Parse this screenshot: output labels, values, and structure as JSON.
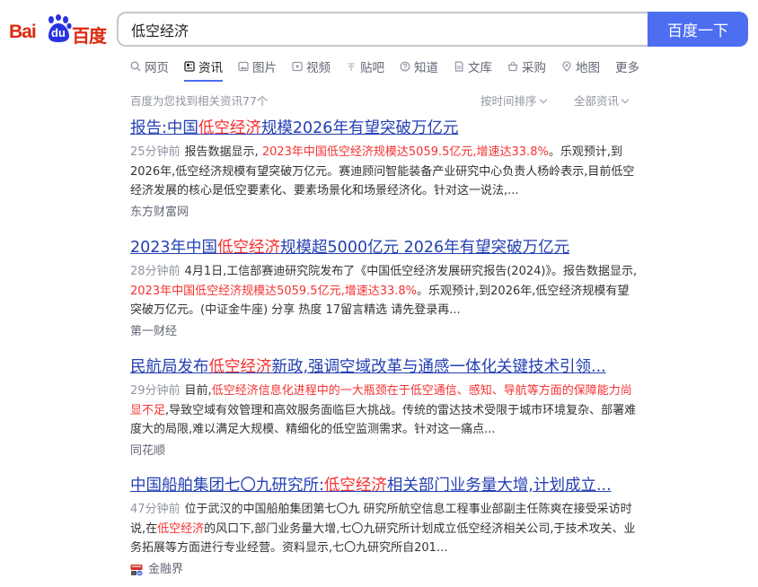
{
  "logo": {
    "bai": "Bai",
    "du": "du",
    "cn": "百度"
  },
  "search": {
    "query": "低空经济",
    "button_label": "百度一下"
  },
  "tabs": [
    {
      "label": "网页",
      "icon": "search-icon"
    },
    {
      "label": "资讯",
      "icon": "news-icon",
      "active": true
    },
    {
      "label": "图片",
      "icon": "image-icon"
    },
    {
      "label": "视频",
      "icon": "video-icon"
    },
    {
      "label": "贴吧",
      "icon": "tieba-icon"
    },
    {
      "label": "知道",
      "icon": "question-icon"
    },
    {
      "label": "文库",
      "icon": "doc-icon"
    },
    {
      "label": "采购",
      "icon": "basket-icon"
    },
    {
      "label": "地图",
      "icon": "map-icon"
    },
    {
      "label": "更多"
    }
  ],
  "meta": {
    "result_count": "百度为您找到相关资讯77个",
    "sort_label": "按时间排序",
    "filter_label": "全部资讯"
  },
  "results": [
    {
      "title": [
        {
          "text": "报告:中国"
        },
        {
          "text": "低空经济",
          "hl": true
        },
        {
          "text": "规模2026年有望突破万亿元"
        }
      ],
      "time": "25分钟前",
      "abstract": [
        {
          "text": "报告数据显示, "
        },
        {
          "text": "2023年中国低空经济规模达5059.5亿元,增速达33.8%",
          "red": true
        },
        {
          "text": "。乐观预计,到2026年,低空经济规模有望突破万亿元。赛迪顾问智能装备产业研究中心负责人杨岭表示,目前低空经济发展的核心是低空要素化、要素场景化和场景经济化。针对这一说法,..."
        }
      ],
      "source": "东方财富网"
    },
    {
      "title": [
        {
          "text": "2023年中国"
        },
        {
          "text": "低空经济",
          "hl": true
        },
        {
          "text": "规模超5000亿元 2026年有望突破万亿元"
        }
      ],
      "time": "28分钟前",
      "abstract": [
        {
          "text": "4月1日,工信部赛迪研究院发布了《中国低空经济发展研究报告(2024)》。报告数据显示, "
        },
        {
          "text": "2023年中国低空经济规模达5059.5亿元,增速达33.8%",
          "red": true
        },
        {
          "text": "。乐观预计,到2026年,低空经济规模有望突破万亿元。(中证金牛座) 分享 热度 17留言精选 请先登录再..."
        }
      ],
      "source": "第一财经"
    },
    {
      "title": [
        {
          "text": "民航局发布"
        },
        {
          "text": "低空经济",
          "hl": true
        },
        {
          "text": "新政,强调空域改革与通感一体化关键技术引领..."
        }
      ],
      "time": "29分钟前",
      "abstract": [
        {
          "text": "目前,"
        },
        {
          "text": "低空经济信息化进程中的一大瓶颈在于低空通信、感知、导航等方面的保障能力尚显不足",
          "red": true
        },
        {
          "text": ",导致空域有效管理和高效服务面临巨大挑战。传统的雷达技术受限于城市环境复杂、部署难度大的局限,难以满足大规模、精细化的低空监测需求。针对这一痛点..."
        }
      ],
      "source": "同花顺"
    },
    {
      "title": [
        {
          "text": "中国船舶集团七〇九研究所:"
        },
        {
          "text": "低空经济",
          "hl": true
        },
        {
          "text": "相关部门业务量大增,计划成立..."
        }
      ],
      "time": "47分钟前",
      "abstract": [
        {
          "text": "位于武汉的中国船舶集团第七〇九 研究所航空信息工程事业部副主任陈爽在接受采访时说,在"
        },
        {
          "text": "低空经济",
          "red": true
        },
        {
          "text": "的风口下,部门业务量大增,七〇九研究所计划成立低空经济相关公司,于技术攻关、业务拓展等方面进行专业经营。资料显示,七〇九研究所自201..."
        }
      ],
      "source": "金融界",
      "source_icon": "jinrongjie-logo-icon"
    }
  ]
}
